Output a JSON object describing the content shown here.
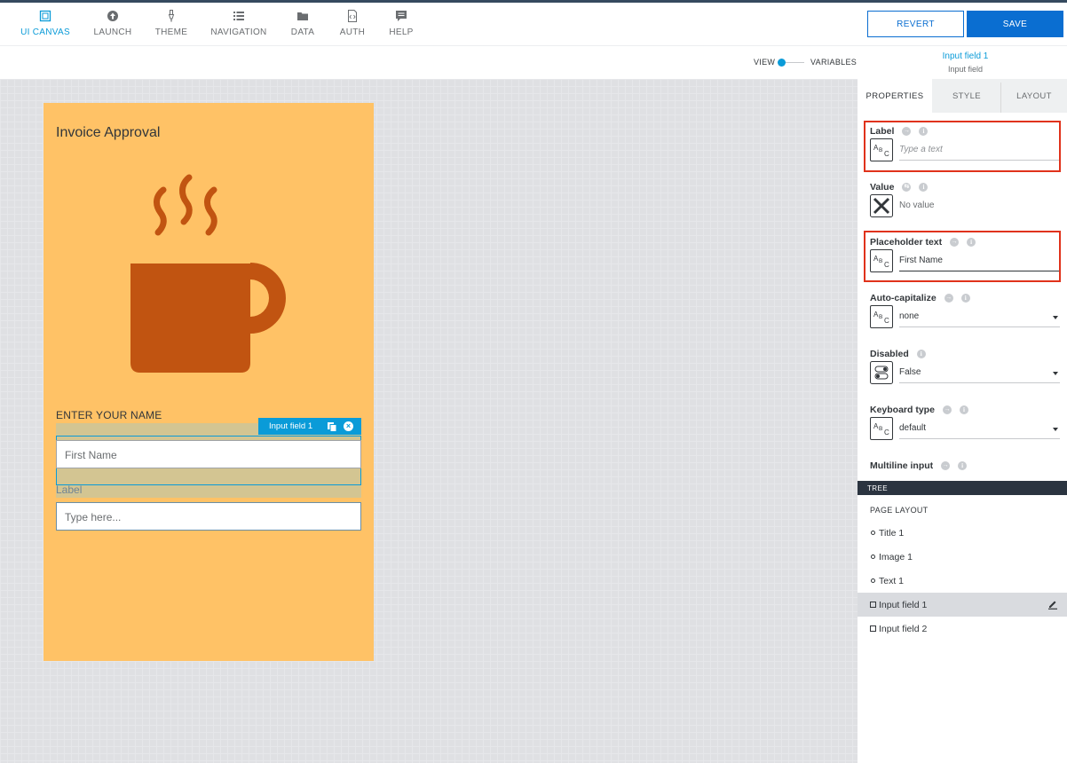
{
  "nav": {
    "items": [
      {
        "label": "UI CANVAS",
        "icon": "canvas-icon",
        "active": true
      },
      {
        "label": "LAUNCH",
        "icon": "launch-icon"
      },
      {
        "label": "THEME",
        "icon": "theme-icon"
      },
      {
        "label": "NAVIGATION",
        "icon": "navigation-icon"
      },
      {
        "label": "DATA",
        "icon": "folder-icon"
      },
      {
        "label": "AUTH",
        "icon": "auth-icon"
      },
      {
        "label": "HELP",
        "icon": "help-icon"
      }
    ],
    "revert_label": "REVERT",
    "save_label": "SAVE"
  },
  "subbar": {
    "view_label": "VIEW",
    "variables_label": "VARIABLES",
    "selected_name": "Input field 1",
    "selected_type": "Input field"
  },
  "canvas": {
    "app_title": "Invoice Approval",
    "image_icon": "coffee-mug-icon",
    "text1": "ENTER YOUR NAME",
    "selection_tag": "Input field 1",
    "field1_value": "First Name",
    "field2_label": "Label",
    "field2_placeholder": "Type here..."
  },
  "panel": {
    "tabs": [
      "PROPERTIES",
      "STYLE",
      "LAYOUT"
    ],
    "active_tab": "PROPERTIES",
    "type_box_text": {
      "a": "A",
      "b": "B",
      "c": "C"
    },
    "props": {
      "label": {
        "title": "Label",
        "placeholder": "Type a text"
      },
      "value": {
        "title": "Value",
        "value": "No value"
      },
      "placeholder_text": {
        "title": "Placeholder text",
        "value": "First Name"
      },
      "auto_capitalize": {
        "title": "Auto-capitalize",
        "value": "none"
      },
      "disabled": {
        "title": "Disabled",
        "value": "False"
      },
      "keyboard_type": {
        "title": "Keyboard type",
        "value": "default"
      },
      "multiline_input": {
        "title": "Multiline input"
      }
    },
    "highlight_color": "#e0321b",
    "tree": {
      "bar_label": "TREE",
      "heading": "PAGE LAYOUT",
      "items": [
        {
          "label": "Title 1"
        },
        {
          "label": "Image 1"
        },
        {
          "label": "Text 1"
        },
        {
          "label": "Input field 1",
          "selected": true
        },
        {
          "label": "Input field 2"
        }
      ]
    }
  },
  "colors": {
    "accent": "#0a9bd8",
    "primary_button": "#0a6ed1",
    "phone_bg": "#ffc266",
    "mug": "#c15411"
  }
}
